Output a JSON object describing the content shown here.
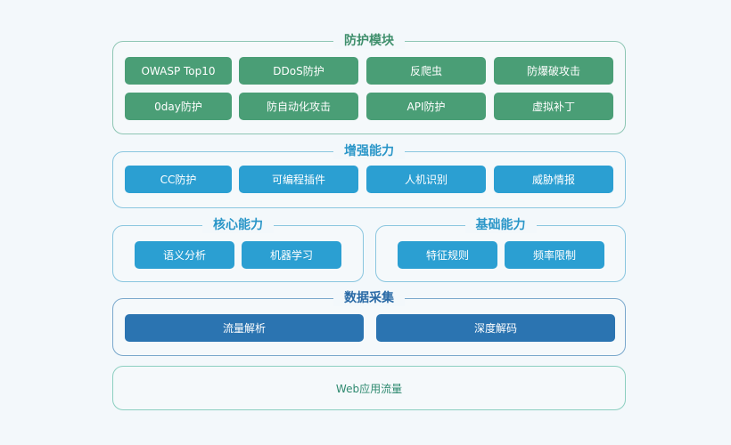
{
  "layers": {
    "protection": {
      "title": "防护模块",
      "items": [
        "OWASP Top10",
        "DDoS防护",
        "反爬虫",
        "防爆破攻击",
        "0day防护",
        "防自动化攻击",
        "API防护",
        "虚拟补丁"
      ]
    },
    "enhanced": {
      "title": "增强能力",
      "items": [
        "CC防护",
        "可编程插件",
        "人机识别",
        "威胁情报"
      ]
    },
    "core": {
      "title": "核心能力",
      "items": [
        "语义分析",
        "机器学习"
      ]
    },
    "basic": {
      "title": "基础能力",
      "items": [
        "特征规则",
        "频率限制"
      ]
    },
    "collection": {
      "title": "数据采集",
      "items": [
        "流量解析",
        "深度解码"
      ]
    },
    "traffic": {
      "label": "Web应用流量"
    }
  },
  "colors": {
    "protection": "#4a9e76",
    "enhanced": "#2b9fd2",
    "collection": "#2b74b1"
  }
}
